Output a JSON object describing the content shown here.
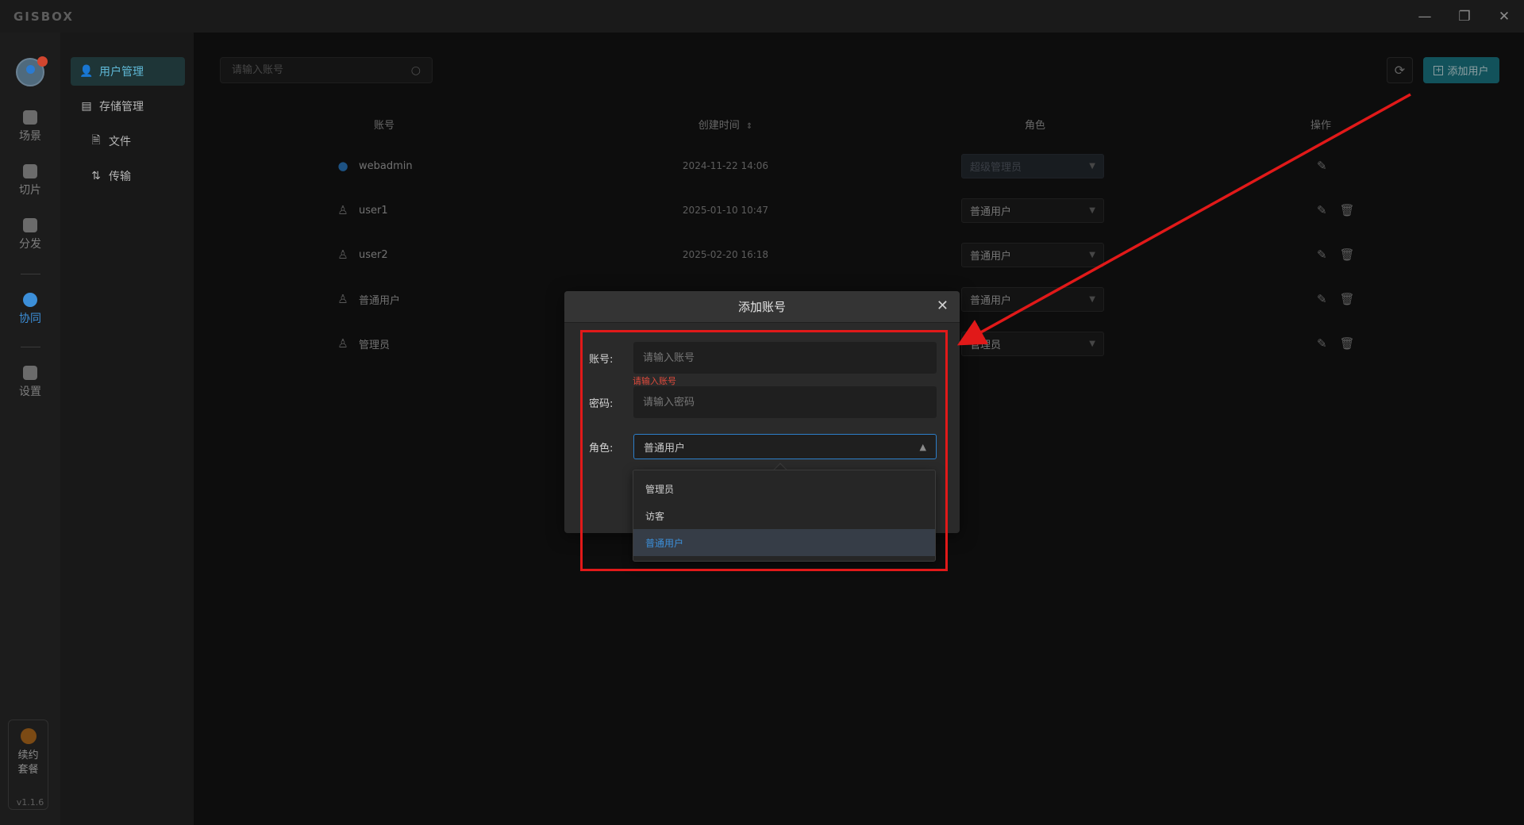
{
  "app": {
    "logo": "GISBOX",
    "version": "v1.1.6"
  },
  "window": {
    "minimize": "—",
    "restore": "❐",
    "close": "✕"
  },
  "rail": {
    "items": [
      {
        "label": "场景",
        "icon": "scene-icon"
      },
      {
        "label": "切片",
        "icon": "slice-icon"
      },
      {
        "label": "分发",
        "icon": "distribute-icon"
      },
      {
        "label": "协同",
        "icon": "collaborate-icon",
        "active": true
      },
      {
        "label": "设置",
        "icon": "settings-icon"
      }
    ],
    "renew_line1": "续约",
    "renew_line2": "套餐"
  },
  "subnav": {
    "items": [
      {
        "label": "用户管理",
        "icon": "user-icon",
        "active": true
      },
      {
        "label": "存储管理",
        "icon": "storage-icon"
      },
      {
        "label": "文件",
        "icon": "file-icon"
      },
      {
        "label": "传输",
        "icon": "transfer-icon"
      }
    ]
  },
  "toolbar": {
    "search_placeholder": "请输入账号",
    "add_user_label": "添加用户"
  },
  "table": {
    "headers": {
      "account": "账号",
      "created": "创建时间",
      "role": "角色",
      "ops": "操作"
    },
    "rows": [
      {
        "account": "webadmin",
        "created": "2024-11-22 14:06",
        "role": "超级管理员"
      },
      {
        "account": "user1",
        "created": "2025-01-10 10:47",
        "role": "普通用户"
      },
      {
        "account": "user2",
        "created": "2025-02-20 16:18",
        "role": "普通用户"
      },
      {
        "account": "普通用户",
        "created": "",
        "role": "普通用户"
      },
      {
        "account": "管理员",
        "created": "",
        "role": "管理员"
      }
    ]
  },
  "dialog": {
    "title": "添加账号",
    "account_label": "账号:",
    "account_placeholder": "请输入账号",
    "account_error": "请输入账号",
    "password_label": "密码:",
    "password_placeholder": "请输入密码",
    "role_label": "角色:",
    "role_value": "普通用户",
    "role_options": [
      "管理员",
      "访客",
      "普通用户"
    ],
    "selected_option": "普通用户"
  },
  "colors": {
    "accent": "#1d7f8c",
    "active_blue": "#3c8fd9",
    "error": "#e04a3c",
    "annotation": "#e11919"
  }
}
